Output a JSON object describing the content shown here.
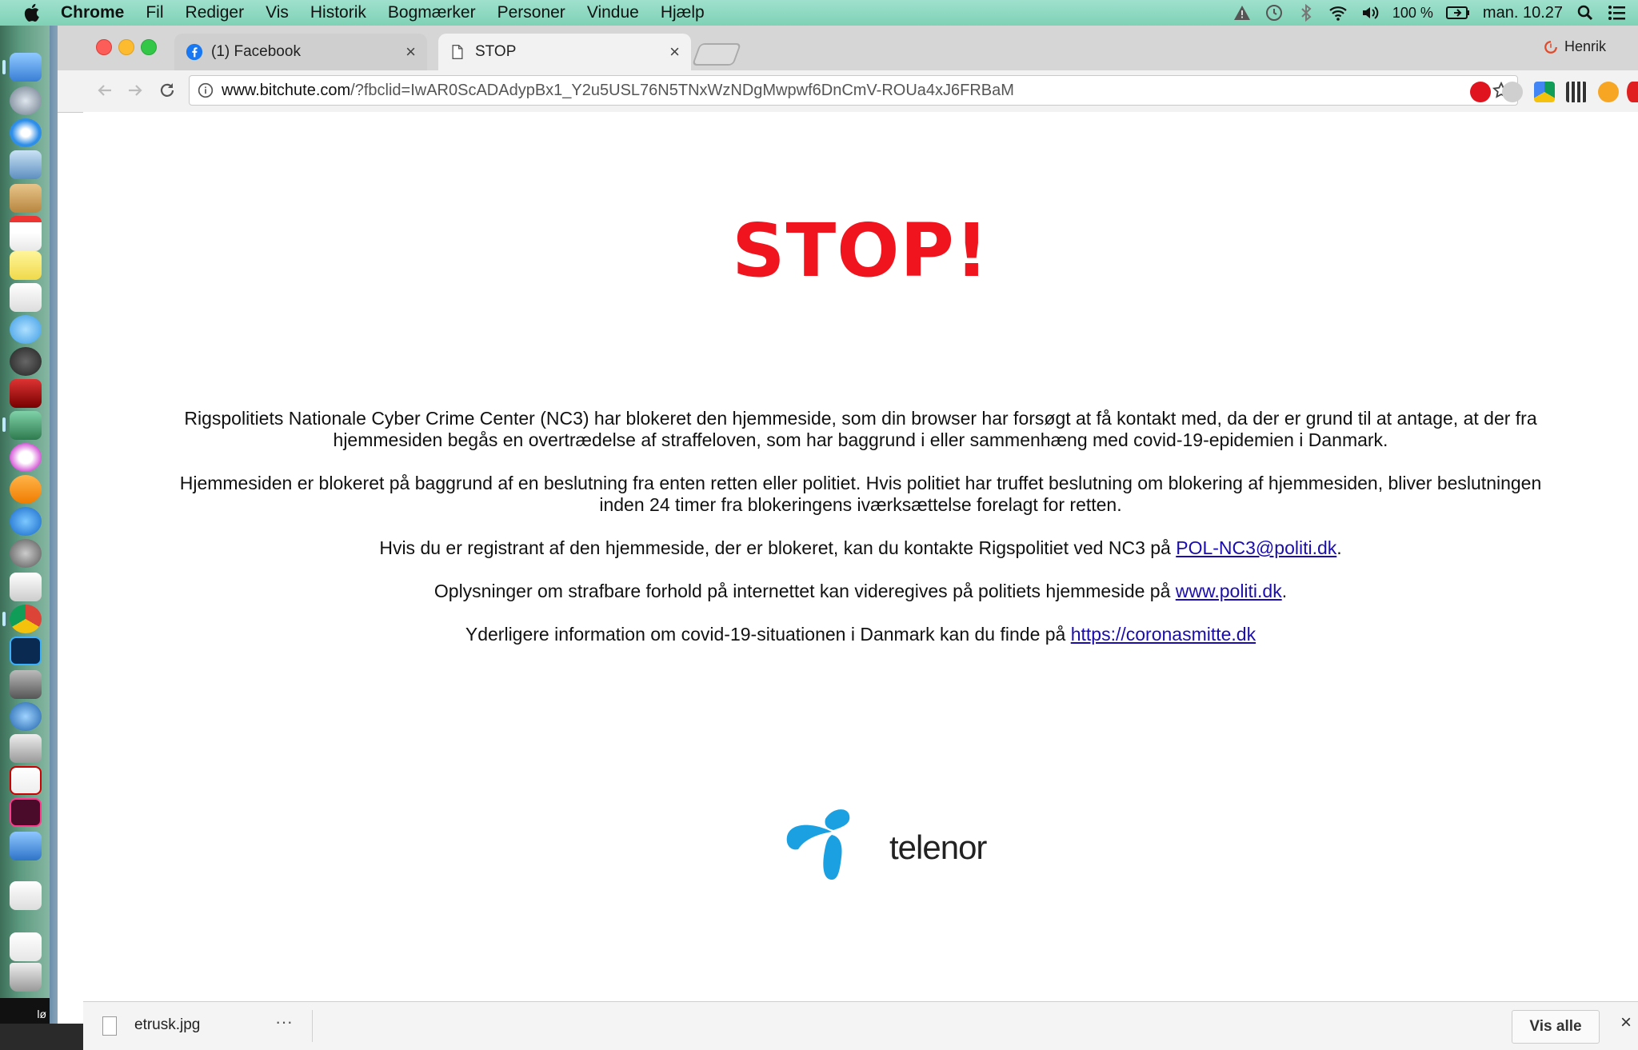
{
  "menubar": {
    "app": "Chrome",
    "items": [
      "Fil",
      "Rediger",
      "Vis",
      "Historik",
      "Bogmærker",
      "Personer",
      "Vindue",
      "Hjælp"
    ],
    "battery": "100 %",
    "clock": "man. 10.27"
  },
  "dock": {
    "label": "lø"
  },
  "tabs": [
    {
      "title": "(1) Facebook",
      "close": "×"
    },
    {
      "title": "STOP",
      "close": "×"
    }
  ],
  "profile": {
    "name": "Henrik"
  },
  "address": {
    "host": "www.bitchute.com",
    "path": "/?fbclid=IwAR0ScADAdypBx1_Y2u5USL76N5TNxWzNDgMwpwf6DnCmV-ROUa4xJ6FRBaM"
  },
  "page": {
    "heading": "STOP!",
    "p1_line1": "Rigspolitiets Nationale Cyber Crime Center (NC3) har blokeret den hjemmeside, som din browser har forsøgt at få kontakt med, da der er grund til at antage, at der fra",
    "p1_line2": "hjemmesiden begås en overtrædelse af straffeloven, som har baggrund i eller sammenhæng med covid-19-epidemien i Danmark.",
    "p2_line1": "Hjemmesiden er blokeret på baggrund af en beslutning fra enten retten eller politiet. Hvis politiet har truffet beslutning om blokering af hjemmesiden, bliver beslutningen",
    "p2_line2": "inden 24 timer fra blokeringens iværksættelse forelagt for retten.",
    "p3_text": "Hvis du er registrant af den hjemmeside, der er blokeret, kan du kontakte Rigspolitiet ved NC3 på ",
    "p3_link": "POL-NC3@politi.dk",
    "p3_end": ".",
    "p4_text": "Oplysninger om strafbare forhold på internettet kan videregives på politiets hjemmeside på ",
    "p4_link": "www.politi.dk",
    "p4_end": ".",
    "p5_text": "Yderligere information om covid-19-situationen i Danmark kan du finde på ",
    "p5_link": "https://coronasmitte.dk",
    "logo_text": "telenor"
  },
  "download_shelf": {
    "filename": "etrusk.jpg",
    "more": "···",
    "show_all": "Vis alle",
    "close": "×"
  },
  "colors": {
    "stop_red": "#f0141e",
    "link_blue": "#1a0dab",
    "telenor_blue": "#1ba1e2"
  }
}
